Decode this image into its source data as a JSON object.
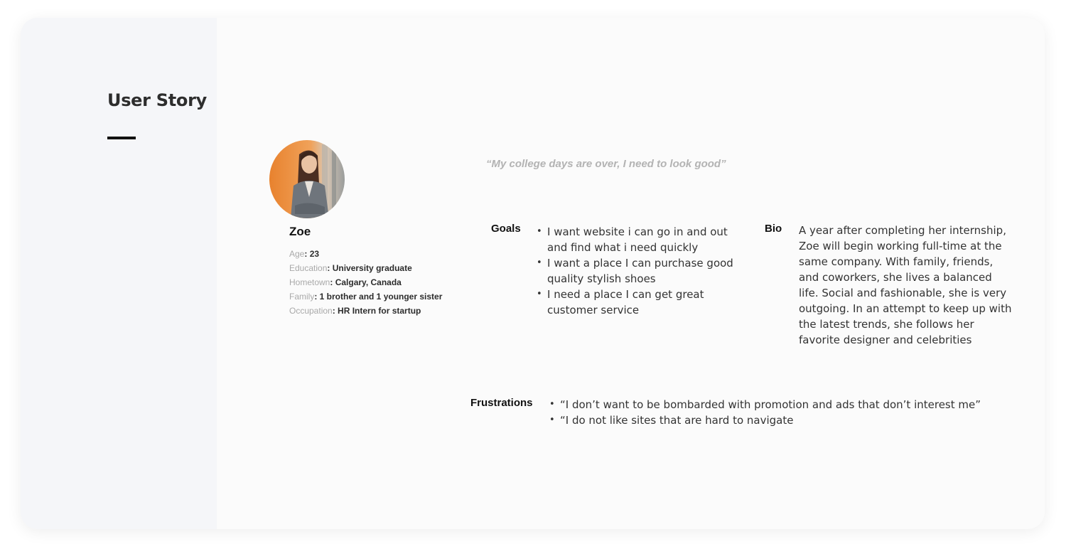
{
  "section": {
    "title": "User Story"
  },
  "persona": {
    "name": "Zoe",
    "photo_icon": "persona-photo",
    "quote": "“My college days are over, I need to look good”",
    "facts": [
      {
        "key": "Age",
        "value": ": 23"
      },
      {
        "key": "Education",
        "value": ": University graduate"
      },
      {
        "key": "Hometown",
        "value": ": Calgary, Canada"
      },
      {
        "key": "Family",
        "value": ": 1 brother and 1 younger sister"
      },
      {
        "key": "Occupation",
        "value": ": HR Intern for startup"
      }
    ]
  },
  "goals": {
    "label": "Goals",
    "items": [
      "I want website i can go in and out and find what i need quickly",
      "I want a place I can purchase good quality stylish shoes",
      "I need a place I can get great customer service"
    ]
  },
  "bio": {
    "label": "Bio",
    "text": "A year after completing her internship, Zoe will begin working full-time at the same company. With family, friends, and coworkers, she lives a balanced life. Social and fashionable, she is very outgoing. In an attempt to keep up with the latest trends, she follows her favorite designer and celebrities"
  },
  "frustrations": {
    "label": "Frustrations",
    "items": [
      "“I don’t want to be bombarded with promotion and ads that don’t interest me”",
      "“I do not like sites that are hard to navigate"
    ]
  },
  "colors": {
    "card": "#fbfbfb",
    "sidebar": "#f5f6f9",
    "quote": "#b3b3b3",
    "fact_key": "#a9a9a9",
    "accent": "#111111"
  }
}
